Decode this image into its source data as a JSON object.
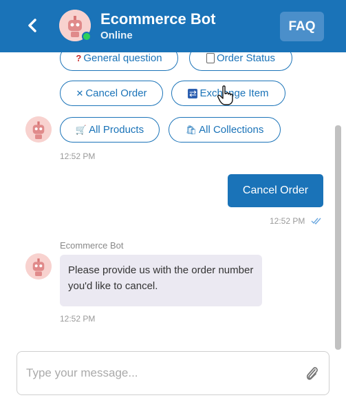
{
  "header": {
    "title": "Ecommerce Bot",
    "status": "Online",
    "faq_label": "FAQ",
    "colors": {
      "background": "#1a73b8",
      "online": "#2fd15a",
      "faq": "#4b8fca"
    }
  },
  "quick_replies": [
    {
      "label": "General question",
      "icon": "question-mark-icon"
    },
    {
      "label": "Order Status",
      "icon": "document-icon"
    },
    {
      "label": "Cancel Order",
      "icon": "close-icon"
    },
    {
      "label": "Exchange Item",
      "icon": "exchange-icon"
    },
    {
      "label": "All Products",
      "icon": "shopping-cart-icon"
    },
    {
      "label": "All Collections",
      "icon": "shopping-bag-icon"
    }
  ],
  "messages": [
    {
      "from": "bot",
      "type": "quick_replies",
      "time": "12:52 PM"
    },
    {
      "from": "user",
      "text": "Cancel Order",
      "time": "12:52 PM",
      "read": true
    },
    {
      "from": "bot",
      "sender": "Ecommerce Bot",
      "text": "Please provide us with the order number you'd like to cancel.",
      "time": "12:52 PM"
    }
  ],
  "composer": {
    "placeholder": "Type your message...",
    "value": ""
  }
}
